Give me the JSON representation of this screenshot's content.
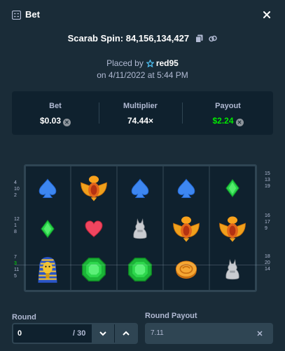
{
  "header": {
    "title": "Bet"
  },
  "spin": {
    "title": "Scarab Spin: 84,156,134,427"
  },
  "placed": {
    "prefix": "Placed by",
    "user": "red95",
    "date": "on 4/11/2022 at 5:44 PM"
  },
  "stats": {
    "bet": {
      "label": "Bet",
      "value": "$0.03"
    },
    "multiplier": {
      "label": "Multiplier",
      "value": "74.44×"
    },
    "payout": {
      "label": "Payout",
      "value": "$2.24"
    }
  },
  "reels": [
    [
      "spade",
      "scarab",
      "spade",
      "spade",
      "diamond"
    ],
    [
      "diamond",
      "heart",
      "cat",
      "scarab",
      "scarab"
    ],
    [
      "pharaoh",
      "emerald",
      "emerald",
      "coin",
      "cat"
    ]
  ],
  "paylines_left": [
    [
      "4",
      "10",
      "2"
    ],
    [
      "12",
      "1",
      "8"
    ],
    [
      "7",
      "3",
      "11",
      "5"
    ]
  ],
  "paylines_right": [
    [
      "15",
      "13",
      "19"
    ],
    [
      "16",
      "17",
      "9"
    ],
    [
      "18",
      "20",
      "14"
    ]
  ],
  "highlighted_payline": "3",
  "round": {
    "label": "Round",
    "value": "0",
    "total": "/ 30"
  },
  "round_payout": {
    "label": "Round Payout",
    "value": "7.11"
  },
  "colors": {
    "background": "#1a2c38",
    "panel": "#0f212e",
    "border": "#2f4553",
    "accent_green": "#00e701",
    "muted": "#b1bad3"
  }
}
